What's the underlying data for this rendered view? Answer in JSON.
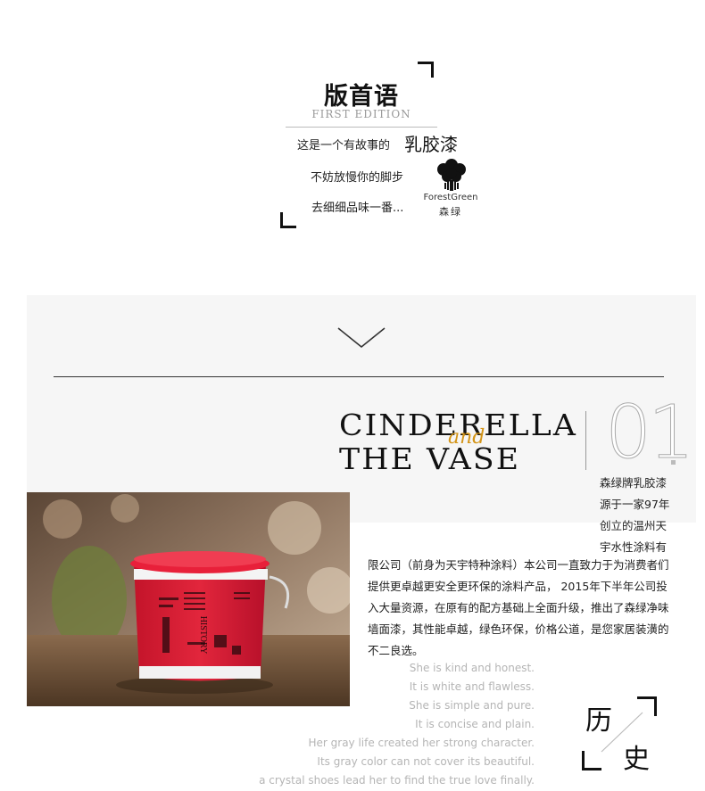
{
  "header": {
    "title": "版首语",
    "subtitle": "FIRST EDITION",
    "line1": "这是一个有故事的",
    "line1_emphasis": "乳胶漆",
    "line2": "不妨放慢你的脚步",
    "line3": "去细细品味一番..."
  },
  "logo": {
    "name_en": "ForestGreen",
    "name_cn": "森绿",
    "icon": "tree-logo-icon"
  },
  "feature": {
    "title_line1": "CINDERELLA",
    "title_line2": "THE VASE",
    "title_connector": "and",
    "number": "01",
    "accent_color": "#d49518"
  },
  "photo": {
    "brand_text": "HISTORY"
  },
  "intro": {
    "right_lines": [
      "森绿牌乳胶漆",
      "源于一家97年",
      "创立的温州天",
      "宇水性涂料有"
    ],
    "paragraph": "限公司（前身为天宇特种涂料）本公司一直致力于为消费者们提供更卓越更安全更环保的涂料产品， 2015年下半年公司投入大量资源，在原有的配方基础上全面升级，推出了森绿净味墙面漆，其性能卓越，绿色环保，价格公道，是您家居装潢的不二良选。"
  },
  "english_lines": [
    "She is kind and honest.",
    "It is white and flawless.",
    "She is simple and pure.",
    "It is concise and  plain.",
    "Her gray life created her strong character.",
    "Its gray color can not cover its beautiful.",
    "a crystal shoes lead her to find the true love finally."
  ],
  "history_badge": {
    "char1": "历",
    "char2": "史"
  }
}
